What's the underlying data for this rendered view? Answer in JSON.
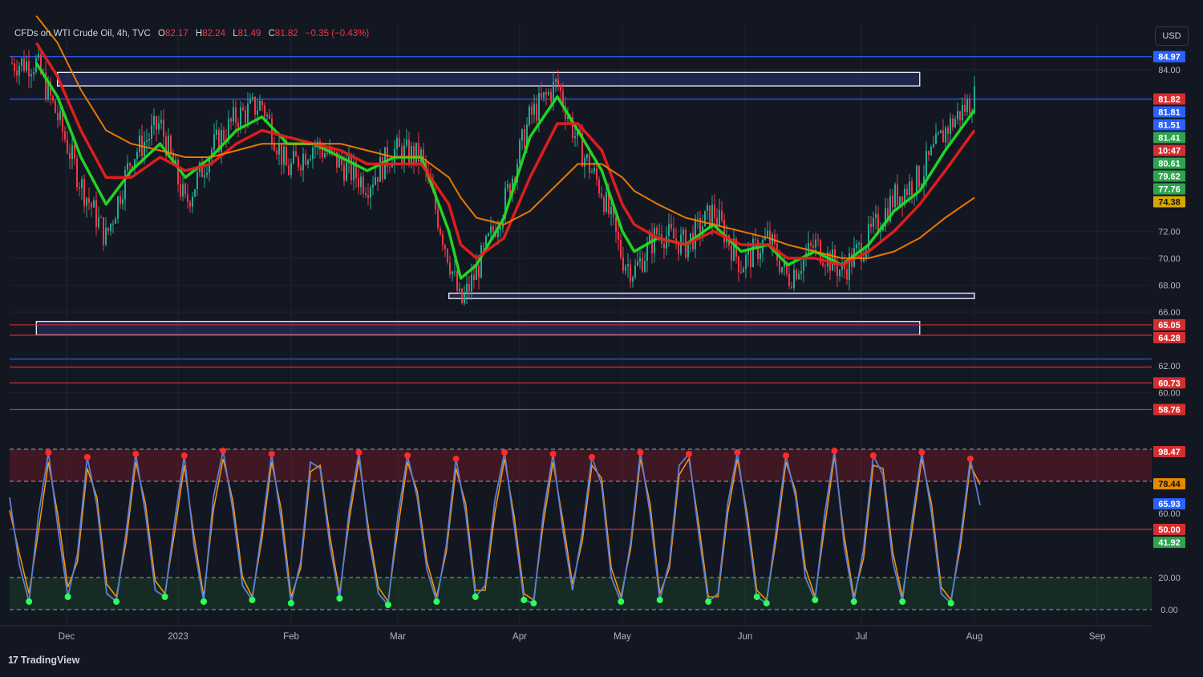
{
  "header": {
    "symbol": "CFDs on WTI Crude Oil, 4h, TVC",
    "open_label": "O",
    "open": "82.17",
    "high_label": "H",
    "high": "82.24",
    "low_label": "L",
    "low": "81.49",
    "close_label": "C",
    "close": "81.82",
    "change": "−0.35 (−0.43%)"
  },
  "currency_button": "USD",
  "brand": {
    "name": "TradingView",
    "logo_glyph": "17"
  },
  "colors": {
    "background": "#131722",
    "grid": "#1f2330",
    "bull": "#22ab94",
    "bear": "#f23645",
    "ema_green": "#22dd22",
    "ema_red": "#e81e1e",
    "ema_orange": "#f57c00",
    "ema_yellow": "#e0b000",
    "stoch_k": "#5b7fd6",
    "stoch_d": "#ff9800",
    "level_blue": "#2962ff",
    "level_red": "#d32f2f"
  },
  "chart_data": [
    {
      "type": "candlestick",
      "title": "CFDs on WTI Crude Oil, 4h, TVC",
      "x_ticks": [
        "Dec",
        "2023",
        "Feb",
        "Mar",
        "Apr",
        "May",
        "Jun",
        "Jul",
        "Aug",
        "Sep"
      ],
      "ylim": [
        57,
        86.5
      ],
      "y_ticks": [
        "84.00",
        "72.00",
        "70.00",
        "68.00",
        "66.00",
        "62.00",
        "60.00"
      ],
      "price_series": {
        "x": [
          "Nov 21",
          "Nov 28",
          "Dec 5",
          "Dec 12",
          "Dec 19",
          "Dec 27",
          "Jan 3",
          "Jan 10",
          "Jan 17",
          "Jan 24",
          "Jan 31",
          "Feb 7",
          "Feb 14",
          "Feb 21",
          "Feb 28",
          "Mar 7",
          "Mar 14",
          "Mar 17",
          "Mar 21",
          "Mar 28",
          "Apr 4",
          "Apr 12",
          "Apr 18",
          "Apr 25",
          "May 1",
          "May 4",
          "May 10",
          "May 17",
          "May 24",
          "May 31",
          "Jun 7",
          "Jun 12",
          "Jun 19",
          "Jun 26",
          "Jul 3",
          "Jul 10",
          "Jul 17",
          "Jul 24",
          "Aug 1"
        ],
        "y": [
          84.5,
          80.5,
          75.5,
          71.5,
          77.5,
          80.0,
          74.0,
          78.0,
          80.5,
          81.5,
          76.5,
          78.5,
          77.0,
          75.5,
          78.0,
          77.5,
          70.0,
          66.5,
          69.0,
          74.0,
          80.5,
          83.0,
          78.5,
          75.0,
          70.0,
          69.0,
          72.0,
          71.0,
          73.5,
          69.5,
          71.5,
          68.5,
          71.0,
          69.0,
          71.5,
          74.5,
          76.0,
          79.5,
          82.0
        ]
      },
      "ema_lines": [
        {
          "color": "green",
          "y": [
            84.5,
            82.0,
            77.5,
            74.0,
            76.5,
            78.5,
            76.0,
            77.5,
            79.5,
            80.5,
            78.5,
            78.5,
            77.5,
            76.5,
            77.5,
            77.5,
            72.0,
            68.5,
            69.5,
            73.0,
            79.0,
            82.0,
            79.5,
            76.5,
            72.0,
            70.5,
            71.5,
            71.0,
            72.5,
            70.5,
            71.0,
            69.5,
            70.5,
            69.5,
            71.0,
            73.5,
            75.0,
            78.0,
            81.0
          ]
        },
        {
          "color": "red",
          "y": [
            86.0,
            83.5,
            79.5,
            76.0,
            76.0,
            77.5,
            76.5,
            77.0,
            78.5,
            79.5,
            79.0,
            78.5,
            78.0,
            77.0,
            77.0,
            77.0,
            74.0,
            71.0,
            70.0,
            71.5,
            76.0,
            80.0,
            80.0,
            78.0,
            74.0,
            72.5,
            71.5,
            71.0,
            72.0,
            71.0,
            71.0,
            70.0,
            70.0,
            69.5,
            70.5,
            72.0,
            74.0,
            76.5,
            79.5
          ]
        },
        {
          "color": "orange",
          "y": [
            88.0,
            86.0,
            82.5,
            79.5,
            78.5,
            78.0,
            77.5,
            77.5,
            78.0,
            78.5,
            78.5,
            78.5,
            78.5,
            78.0,
            77.5,
            77.5,
            76.0,
            74.5,
            73.0,
            72.5,
            73.5,
            75.5,
            77.0,
            77.0,
            76.0,
            75.0,
            74.0,
            73.0,
            72.5,
            72.0,
            71.5,
            71.0,
            70.5,
            70.0,
            70.0,
            70.5,
            71.5,
            73.0,
            74.5
          ]
        }
      ],
      "price_tags": [
        {
          "value": 84.97,
          "label": "84.97",
          "color": "blue"
        },
        {
          "value": 81.82,
          "label": "81.82",
          "color": "red"
        },
        {
          "value": 81.4,
          "label": "10:47",
          "color": "red"
        },
        {
          "value": 81.81,
          "label": "81.81",
          "color": "blue"
        },
        {
          "value": 81.51,
          "label": "81.51",
          "color": "blue"
        },
        {
          "value": 81.41,
          "label": "81.41",
          "color": "green"
        },
        {
          "value": 80.61,
          "label": "80.61",
          "color": "green"
        },
        {
          "value": 79.62,
          "label": "79.62",
          "color": "green"
        },
        {
          "value": 77.76,
          "label": "77.76",
          "color": "green"
        },
        {
          "value": 74.38,
          "label": "74.38",
          "color": "yellow"
        },
        {
          "value": 65.05,
          "label": "65.05",
          "color": "red"
        },
        {
          "value": 64.28,
          "label": "64.28",
          "color": "red"
        },
        {
          "value": 60.73,
          "label": "60.73",
          "color": "red"
        },
        {
          "value": 58.76,
          "label": "58.76",
          "color": "red"
        }
      ],
      "horizontal_levels": [
        {
          "value": 84.97,
          "color": "blue"
        },
        {
          "value": 81.82,
          "color": "blue"
        },
        {
          "value": 65.05,
          "color": "red"
        },
        {
          "value": 64.28,
          "color": "red"
        },
        {
          "value": 62.5,
          "color": "blue"
        },
        {
          "value": 61.9,
          "color": "red"
        },
        {
          "value": 60.73,
          "color": "red"
        },
        {
          "value": 58.76,
          "color": "red"
        }
      ],
      "zones": [
        {
          "from": "Nov 28",
          "to": "Jul 17",
          "low": 82.8,
          "high": 83.8
        },
        {
          "from": "Mar 14",
          "to": "Aug 1",
          "low": 67.0,
          "high": 67.4
        },
        {
          "from": "Nov 21",
          "to": "Jul 17",
          "low": 64.3,
          "high": 65.3
        }
      ]
    },
    {
      "type": "line",
      "title": "",
      "ylim": [
        0,
        100
      ],
      "y_ticks": [
        "60.00",
        "20.00",
        "0.00"
      ],
      "levels": [
        {
          "value": 98.47,
          "label": "98.47",
          "color": "red"
        },
        {
          "value": 78.44,
          "label": "78.44",
          "color": "orange"
        },
        {
          "value": 65.93,
          "label": "65.93",
          "color": "blue"
        },
        {
          "value": 50.0,
          "label": "50.00",
          "color": "red"
        },
        {
          "value": 41.92,
          "label": "41.92",
          "color": "green"
        }
      ],
      "overbought": 80,
      "oversold": 20,
      "series": [
        {
          "color": "blue",
          "values": [
            70,
            28,
            5,
            60,
            98,
            50,
            8,
            35,
            95,
            65,
            10,
            5,
            48,
            97,
            60,
            12,
            8,
            55,
            96,
            40,
            5,
            70,
            99,
            62,
            15,
            6,
            50,
            97,
            55,
            4,
            30,
            92,
            88,
            40,
            7,
            62,
            98,
            45,
            10,
            3,
            58,
            96,
            70,
            25,
            5,
            40,
            94,
            60,
            8,
            15,
            68,
            98,
            52,
            6,
            4,
            60,
            97,
            50,
            12,
            48,
            95,
            78,
            20,
            5,
            42,
            98,
            60,
            6,
            30,
            90,
            97,
            48,
            5,
            10,
            66,
            98,
            55,
            8,
            4,
            50,
            96,
            70,
            20,
            6,
            60,
            99,
            40,
            5,
            38,
            96,
            84,
            30,
            5,
            56,
            98,
            60,
            10,
            4,
            45,
            94,
            65
          ]
        },
        {
          "color": "orange",
          "values": [
            62,
            35,
            10,
            50,
            92,
            58,
            14,
            30,
            88,
            70,
            16,
            8,
            42,
            92,
            66,
            18,
            10,
            48,
            90,
            46,
            8,
            62,
            94,
            68,
            20,
            8,
            44,
            92,
            62,
            8,
            26,
            86,
            90,
            46,
            10,
            56,
            94,
            50,
            14,
            5,
            50,
            92,
            74,
            30,
            8,
            36,
            88,
            66,
            12,
            12,
            60,
            94,
            58,
            10,
            6,
            54,
            92,
            56,
            16,
            42,
            90,
            82,
            26,
            8,
            38,
            94,
            66,
            10,
            26,
            84,
            94,
            54,
            8,
            8,
            60,
            94,
            60,
            12,
            6,
            44,
            92,
            74,
            26,
            8,
            52,
            96,
            46,
            8,
            32,
            90,
            88,
            36,
            8,
            50,
            94,
            66,
            14,
            6,
            40,
            90,
            78
          ]
        }
      ]
    }
  ]
}
